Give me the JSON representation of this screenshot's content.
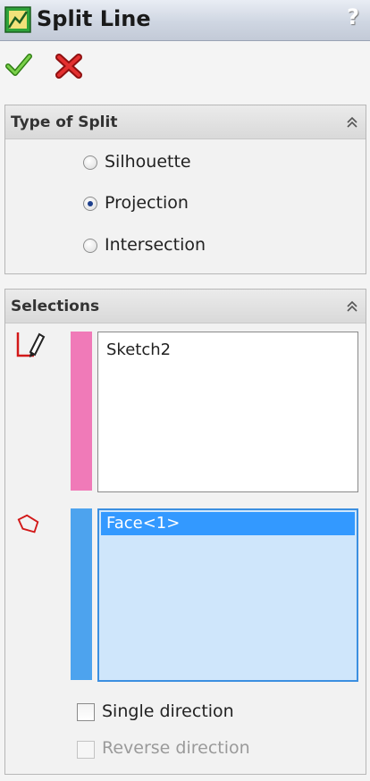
{
  "window": {
    "title": "Split Line",
    "help_label": "?"
  },
  "actions": {
    "ok": "ok",
    "cancel": "cancel"
  },
  "type_of_split": {
    "title": "Type of Split",
    "options": [
      {
        "label": "Silhouette",
        "selected": false
      },
      {
        "label": "Projection",
        "selected": true
      },
      {
        "label": "Intersection",
        "selected": false
      }
    ]
  },
  "selections": {
    "title": "Selections",
    "sketch_list": {
      "items": [
        "Sketch2"
      ],
      "color": "#f07ab8",
      "icon": "sketch-icon"
    },
    "face_list": {
      "items": [
        "Face<1>"
      ],
      "color": "#4da3ee",
      "icon": "face-icon"
    },
    "single_direction": {
      "label": "Single direction",
      "checked": false
    },
    "reverse_direction": {
      "label": "Reverse direction",
      "checked": false,
      "enabled": false
    }
  },
  "colors": {
    "selected_item": "#3399ff",
    "face_list_bg": "#cfe6fb",
    "title_bar": "#cfd6e2"
  }
}
